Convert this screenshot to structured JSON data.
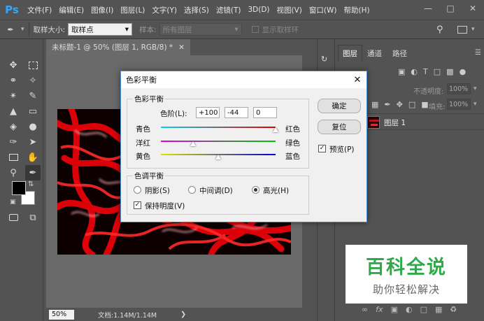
{
  "app": {
    "logo": "Ps"
  },
  "menu": [
    "文件(F)",
    "编辑(E)",
    "图像(I)",
    "图层(L)",
    "文字(Y)",
    "选择(S)",
    "滤镜(T)",
    "3D(D)",
    "视图(V)",
    "窗口(W)",
    "帮助(H)"
  ],
  "options": {
    "sample_size_label": "取样大小:",
    "sample_size_value": "取样点",
    "sample_label": "样本:",
    "sample_value": "所有图层",
    "show_ring_label": "显示取样环"
  },
  "document": {
    "tab_title": "未标题-1 @ 50% (图层 1, RGB/8) *",
    "zoom": "50%",
    "doc_info": "文档:1.14M/1.14M"
  },
  "dialog": {
    "title": "色彩平衡",
    "group1_label": "色彩平衡",
    "levels_label": "色阶(L):",
    "levels": [
      "+100",
      "-44",
      "0"
    ],
    "sliders": [
      {
        "left": "青色",
        "right": "红色",
        "value": 100
      },
      {
        "left": "洋红",
        "right": "绿色",
        "value": -44
      },
      {
        "left": "黄色",
        "right": "蓝色",
        "value": 0
      }
    ],
    "group2_label": "色调平衡",
    "tones": [
      "阴影(S)",
      "中间调(D)",
      "高光(H)"
    ],
    "selected_tone": "高光(H)",
    "preserve_label": "保持明度(V)",
    "ok": "确定",
    "reset": "复位",
    "preview_label": "预览(P)"
  },
  "panels": {
    "tabs": [
      "图层",
      "通道",
      "路径"
    ],
    "opacity_label": "不透明度:",
    "opacity_value": "100%",
    "fill_label": "填充:",
    "fill_value": "100%",
    "layer_name": "图层 1"
  },
  "watermark": {
    "title": "百科全说",
    "subtitle": "助你轻松解决",
    "color": "#2eaa4a"
  }
}
